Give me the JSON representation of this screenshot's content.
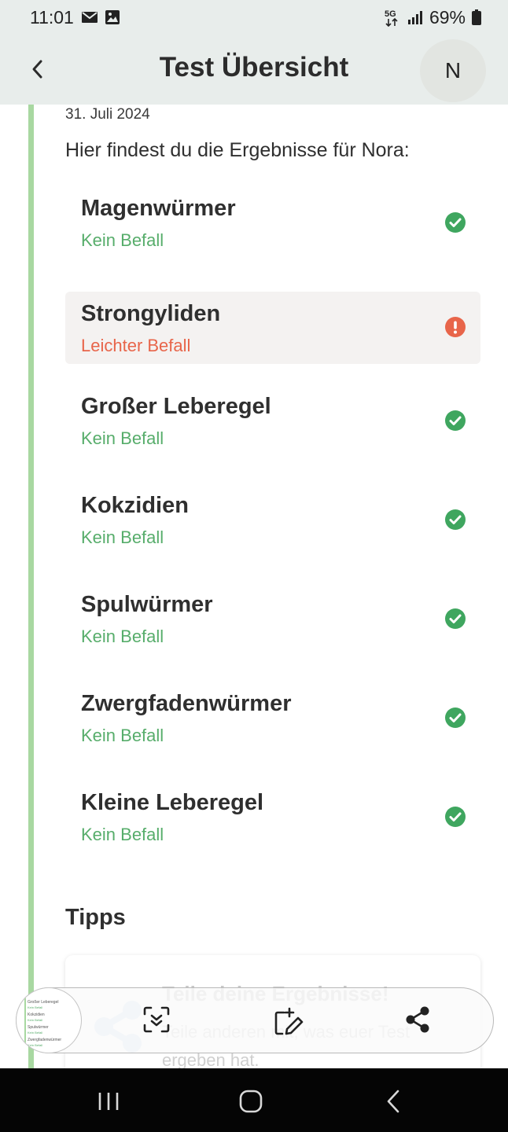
{
  "status_bar": {
    "time": "11:01",
    "battery": "69%",
    "network": "5G",
    "icons": [
      "mail-icon",
      "image-icon",
      "5g-icon",
      "signal-icon",
      "battery-icon"
    ]
  },
  "header": {
    "title": "Test Übersicht",
    "avatar_initial": "N",
    "back_icon": "chevron-left-icon"
  },
  "content": {
    "date": "31. Juli 2024",
    "intro": "Hier findest du die Ergebnisse für Nora:",
    "results": [
      {
        "name": "Magenwürmer",
        "status": "Kein Befall",
        "level": "ok",
        "icon": "check-circle-icon"
      },
      {
        "name": "Strongyliden",
        "status": "Leichter Befall",
        "level": "warning",
        "icon": "alert-circle-icon"
      },
      {
        "name": "Großer Leberegel",
        "status": "Kein Befall",
        "level": "ok",
        "icon": "check-circle-icon"
      },
      {
        "name": "Kokzidien",
        "status": "Kein Befall",
        "level": "ok",
        "icon": "check-circle-icon"
      },
      {
        "name": "Spulwürmer",
        "status": "Kein Befall",
        "level": "ok",
        "icon": "check-circle-icon"
      },
      {
        "name": "Zwergfadenwürmer",
        "status": "Kein Befall",
        "level": "ok",
        "icon": "check-circle-icon"
      },
      {
        "name": "Kleine Leberegel",
        "status": "Kein Befall",
        "level": "ok",
        "icon": "check-circle-icon"
      }
    ],
    "tipps_title": "Tipps",
    "tip_card": {
      "title": "Teile deine Ergebnisse!",
      "text": "Teile anderen mit, was euer Test ergeben hat."
    }
  },
  "screenshot_toolbar": {
    "thumbnail_lines": [
      "Großer Leberegel",
      "Kein Befall",
      "Kokzidien",
      "Kein Befall",
      "Spulwürmer",
      "Kein Befall",
      "Zwergfadenwürmer",
      "Kein Befall"
    ],
    "buttons": [
      "scroll-capture-icon",
      "crop-edit-icon",
      "share-icon"
    ]
  },
  "navbar": {
    "buttons": [
      "recent-apps-icon",
      "home-icon",
      "back-icon"
    ]
  },
  "colors": {
    "header_bg": "#e8edeb",
    "timeline": "#a8d8a1",
    "ok_green": "#3fa65f",
    "status_green": "#57ad6b",
    "warning_red": "#e8654a",
    "warning_bg": "#f4f2f1"
  }
}
